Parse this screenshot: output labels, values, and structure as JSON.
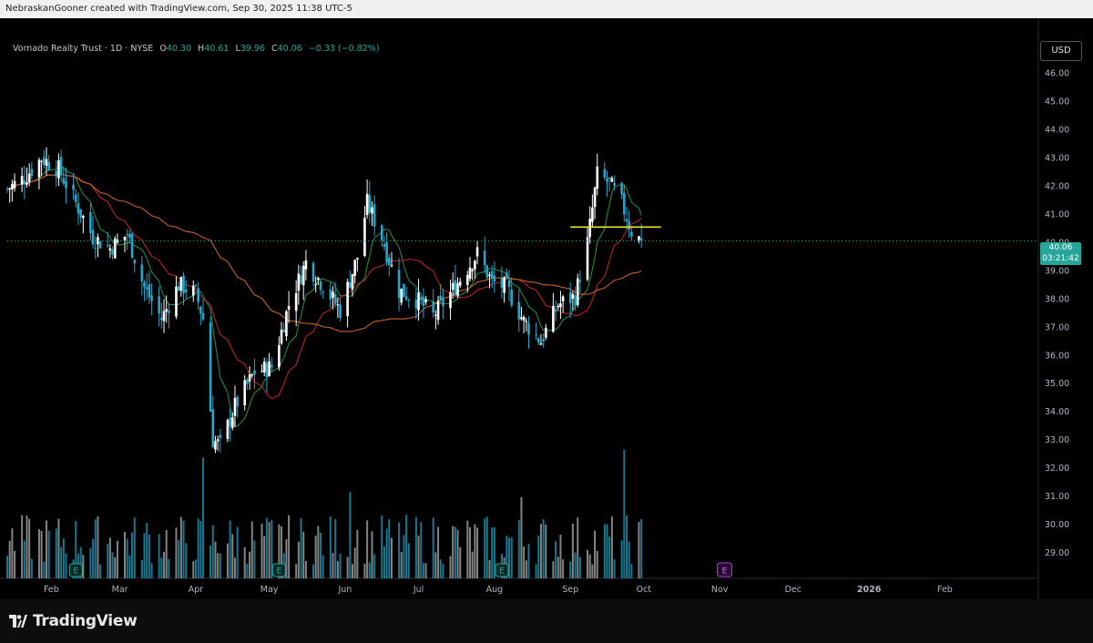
{
  "watermark": "NebraskanGooner created with TradingView.com, Sep 30, 2025 11:38 UTC-5",
  "legend": {
    "symbol": "Vornado Realty Trust · 1D · NYSE",
    "o_label": "O",
    "o": "40.30",
    "h_label": "H",
    "h": "40.61",
    "l_label": "L",
    "l": "39.96",
    "c_label": "C",
    "c": "40.06",
    "change": "−0.33 (−0.82%)"
  },
  "currency": "USD",
  "price_tag": {
    "price": "40.06",
    "countdown": "03:21:42"
  },
  "brand": "TradingView",
  "colors": {
    "up": "#ffffff",
    "down": "#26a6c9",
    "ma_fast": "#1f8a45",
    "ma_mid": "#b2242c",
    "ma_slow": "#c2622a",
    "level": "#e8e82a",
    "current": "#26a69a"
  },
  "chart_data": {
    "type": "candlestick",
    "x_ticks": [
      "Feb",
      "Mar",
      "Apr",
      "May",
      "Jun",
      "Jul",
      "Aug",
      "Sep",
      "Oct",
      "Nov",
      "Dec",
      "2026",
      "Feb"
    ],
    "y_ticks": [
      "46.00",
      "45.00",
      "44.00",
      "43.00",
      "42.00",
      "41.00",
      "40.00",
      "39.00",
      "38.00",
      "37.00",
      "36.00",
      "35.00",
      "34.00",
      "33.00",
      "32.00",
      "31.00",
      "30.00",
      "29.00"
    ],
    "ylim": [
      28.0,
      46.6
    ],
    "close_path": [
      [
        "2025-01-14",
        41.9
      ],
      [
        "2025-01-21",
        42.3
      ],
      [
        "2025-01-28",
        43.0
      ],
      [
        "2025-02-04",
        42.6
      ],
      [
        "2025-02-11",
        41.4
      ],
      [
        "2025-02-18",
        40.2
      ],
      [
        "2025-02-25",
        39.8
      ],
      [
        "2025-03-04",
        40.3
      ],
      [
        "2025-03-11",
        38.4
      ],
      [
        "2025-03-18",
        37.3
      ],
      [
        "2025-03-25",
        38.5
      ],
      [
        "2025-04-01",
        38.2
      ],
      [
        "2025-04-04",
        37.3
      ],
      [
        "2025-04-08",
        33.0
      ],
      [
        "2025-04-11",
        32.8
      ],
      [
        "2025-04-17",
        34.2
      ],
      [
        "2025-04-25",
        35.4
      ],
      [
        "2025-05-02",
        35.6
      ],
      [
        "2025-05-09",
        37.8
      ],
      [
        "2025-05-16",
        39.3
      ],
      [
        "2025-05-23",
        38.5
      ],
      [
        "2025-05-30",
        37.6
      ],
      [
        "2025-06-06",
        39.5
      ],
      [
        "2025-06-10",
        41.4
      ],
      [
        "2025-06-16",
        40.2
      ],
      [
        "2025-06-23",
        38.3
      ],
      [
        "2025-06-30",
        38.0
      ],
      [
        "2025-07-07",
        37.4
      ],
      [
        "2025-07-14",
        38.2
      ],
      [
        "2025-07-21",
        39.1
      ],
      [
        "2025-07-25",
        39.6
      ],
      [
        "2025-07-31",
        38.6
      ],
      [
        "2025-08-06",
        38.4
      ],
      [
        "2025-08-13",
        37.2
      ],
      [
        "2025-08-20",
        36.5
      ],
      [
        "2025-08-27",
        37.8
      ],
      [
        "2025-09-03",
        38.1
      ],
      [
        "2025-09-08",
        40.0
      ],
      [
        "2025-09-12",
        42.4
      ],
      [
        "2025-09-17",
        42.1
      ],
      [
        "2025-09-22",
        41.4
      ],
      [
        "2025-09-26",
        40.4
      ],
      [
        "2025-09-30",
        40.06
      ]
    ],
    "events": {
      "earnings_past": [
        "Feb",
        "May",
        "Aug"
      ],
      "earnings_upcoming": [
        "Nov"
      ]
    },
    "horizontal_level": 40.55,
    "last_price": 40.06,
    "moving_averages": [
      "fast",
      "mid",
      "slow"
    ],
    "grid": false
  }
}
